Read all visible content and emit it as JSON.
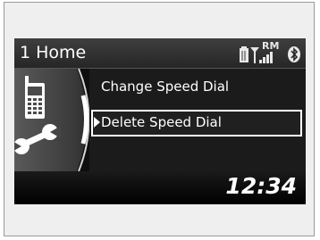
{
  "header": {
    "title": "1 Home",
    "status_text": "RM",
    "icons": [
      "phone-battery-icon",
      "signal-strength-icon",
      "bluetooth-icon"
    ]
  },
  "menu": {
    "items": [
      {
        "label": "Change Speed Dial",
        "selected": false
      },
      {
        "label": "Delete Speed Dial",
        "selected": true
      }
    ]
  },
  "side_icon": "phone-settings-icon",
  "footer": {
    "clock": "12:34"
  },
  "colors": {
    "screen_bg": "#0c0c0c",
    "text": "#ffffff",
    "panel": "#4a4a4a"
  }
}
